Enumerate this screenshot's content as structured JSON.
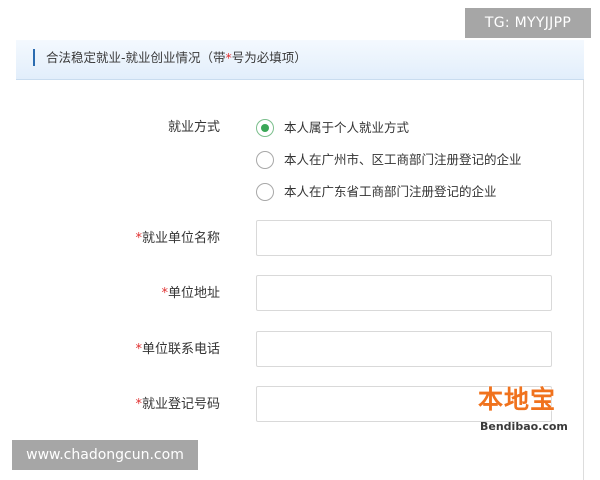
{
  "section": {
    "title_prefix": "合法稳定就业-就业创业情况（带",
    "required_mark": "*",
    "title_suffix": "号为必填项）"
  },
  "employment_mode": {
    "label": "就业方式",
    "options": [
      {
        "label": "本人属于个人就业方式",
        "checked": true
      },
      {
        "label": "本人在广州市、区工商部门注册登记的企业",
        "checked": false
      },
      {
        "label": "本人在广东省工商部门注册登记的企业",
        "checked": false
      }
    ]
  },
  "fields": [
    {
      "required_mark": "*",
      "label": "就业单位名称",
      "value": ""
    },
    {
      "required_mark": "*",
      "label": "单位地址",
      "value": ""
    },
    {
      "required_mark": "*",
      "label": "单位联系电话",
      "value": ""
    },
    {
      "required_mark": "*",
      "label": "就业登记号码",
      "value": ""
    }
  ],
  "watermarks": {
    "tag": "TG: MYYJJPP",
    "url": "www.chadongcun.com",
    "logo_cn": "本地宝",
    "logo_en": "Bendibao.com"
  },
  "colors": {
    "accent_blue": "#2b6cb0",
    "required_red": "#e03030",
    "radio_green": "#3aa757",
    "logo_orange": "#f0721d"
  }
}
